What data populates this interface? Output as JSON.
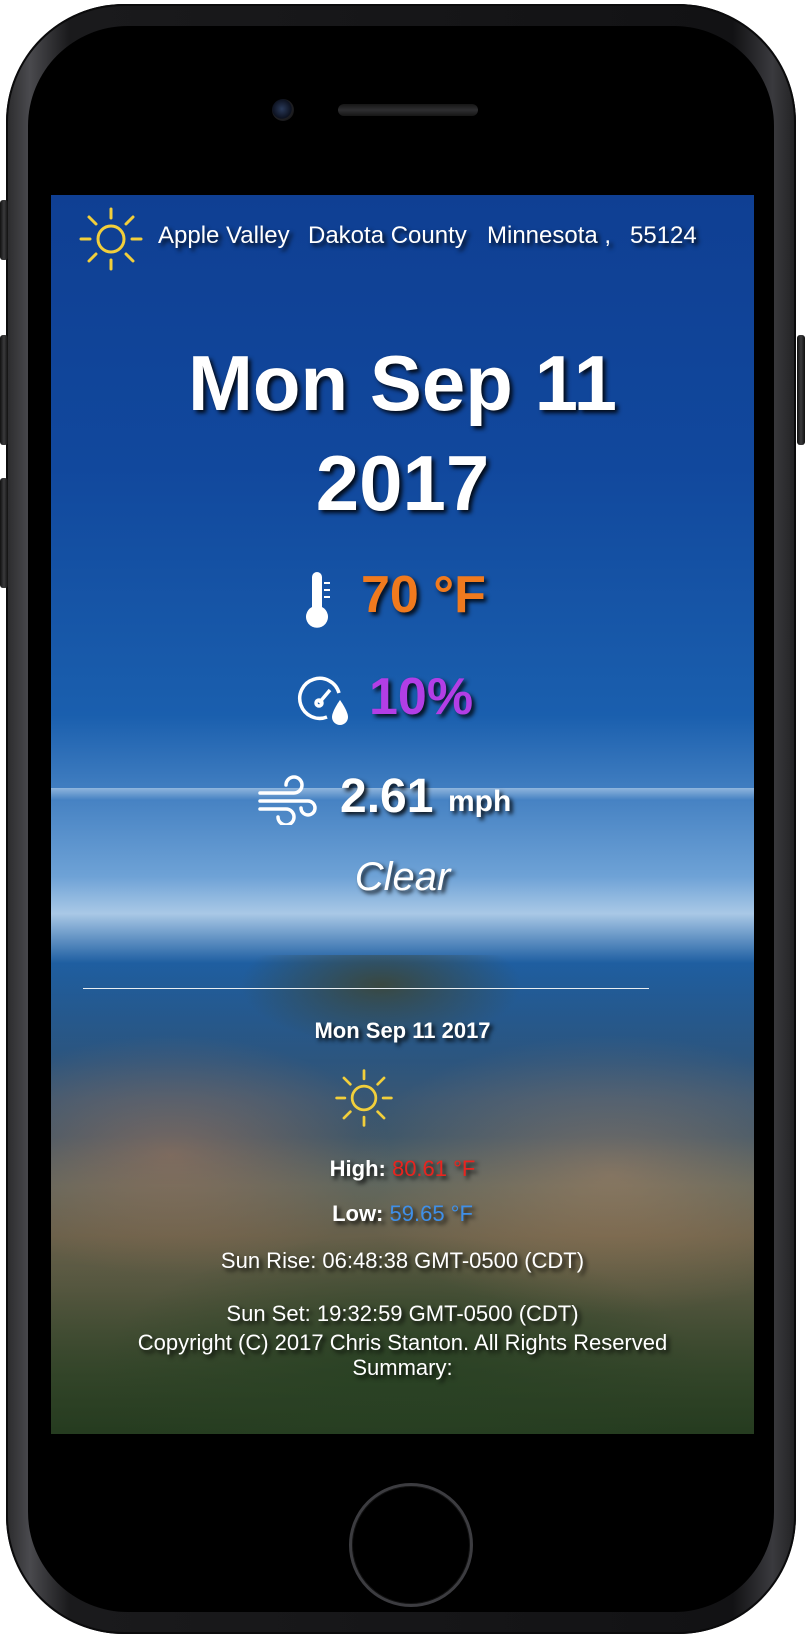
{
  "header": {
    "city": "Apple Valley",
    "county": "Dakota County",
    "state": "Minnesota ,",
    "zip": "55124",
    "icon": "sun-icon"
  },
  "today": {
    "date_line1": "Mon Sep 11",
    "date_line2": "2017",
    "temperature": "70 °F",
    "humidity": "10%",
    "wind_speed": "2.61",
    "wind_unit": "mph",
    "condition": "Clear"
  },
  "forecast": {
    "date": "Mon Sep 11 2017",
    "high_label": "High:",
    "high_value": "80.61 °F",
    "low_label": "Low:",
    "low_value": "59.65 °F",
    "sunrise": "Sun Rise: 06:48:38 GMT-0500 (CDT)",
    "sunset": "Sun Set: 19:32:59 GMT-0500 (CDT)",
    "copyright": "Copyright (C) 2017 Chris Stanton. All Rights Reserved",
    "summary_label": "Summary:"
  },
  "colors": {
    "temperature": "#f07a1e",
    "humidity": "#b23ee6",
    "high": "#e8241f",
    "low": "#3f8fe8",
    "sun_icon": "#f2cf3b"
  }
}
